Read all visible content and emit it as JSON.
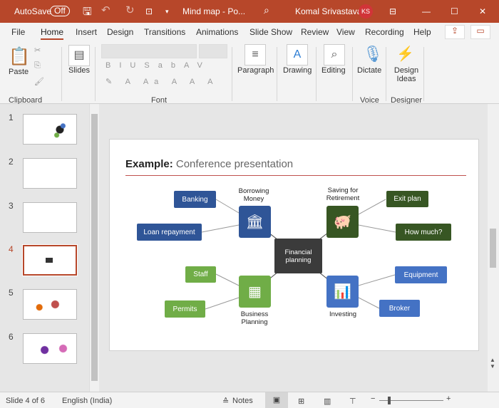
{
  "titlebar": {
    "autosave": "AutoSave",
    "autosave_state": "Off",
    "doc_title": "Mind map  -  Po...",
    "user": "Komal Srivastava",
    "initials": "KS"
  },
  "tabs": [
    "File",
    "Home",
    "Insert",
    "Design",
    "Transitions",
    "Animations",
    "Slide Show",
    "Review",
    "View",
    "Recording",
    "Help"
  ],
  "ribbon": {
    "paste": "Paste",
    "slides": "Slides",
    "paragraph": "Paragraph",
    "drawing": "Drawing",
    "editing": "Editing",
    "dictate": "Dictate",
    "design_ideas": "Design Ideas",
    "groups": {
      "clipboard": "Clipboard",
      "font": "Font",
      "voice": "Voice",
      "designer": "Designer"
    },
    "font_buttons": [
      "B",
      "I",
      "U",
      "S",
      "ab",
      "AV"
    ]
  },
  "thumbnails": [
    "1",
    "2",
    "3",
    "4",
    "5",
    "6"
  ],
  "slide": {
    "title_bold": "Example:",
    "title_rest": " Conference presentation",
    "center": "Financial planning",
    "branches": {
      "borrowing": "Borrowing Money",
      "saving": "Saving for Retirement",
      "business": "Business Planning",
      "investing": "Investing"
    },
    "leaves": {
      "banking": "Banking",
      "loan": "Loan repayment",
      "exit": "Exit plan",
      "howmuch": "How much?",
      "staff": "Staff",
      "permits": "Permits",
      "equipment": "Equipment",
      "broker": "Broker"
    }
  },
  "status": {
    "slide": "Slide 4 of 6",
    "language": "English (India)",
    "notes": "Notes"
  },
  "colors": {
    "accent": "#b7472a",
    "blue": "#2f5597",
    "darkgreen": "#375623",
    "green": "#70ad47",
    "lightblue": "#4472c4",
    "center": "#3b3b3b"
  }
}
